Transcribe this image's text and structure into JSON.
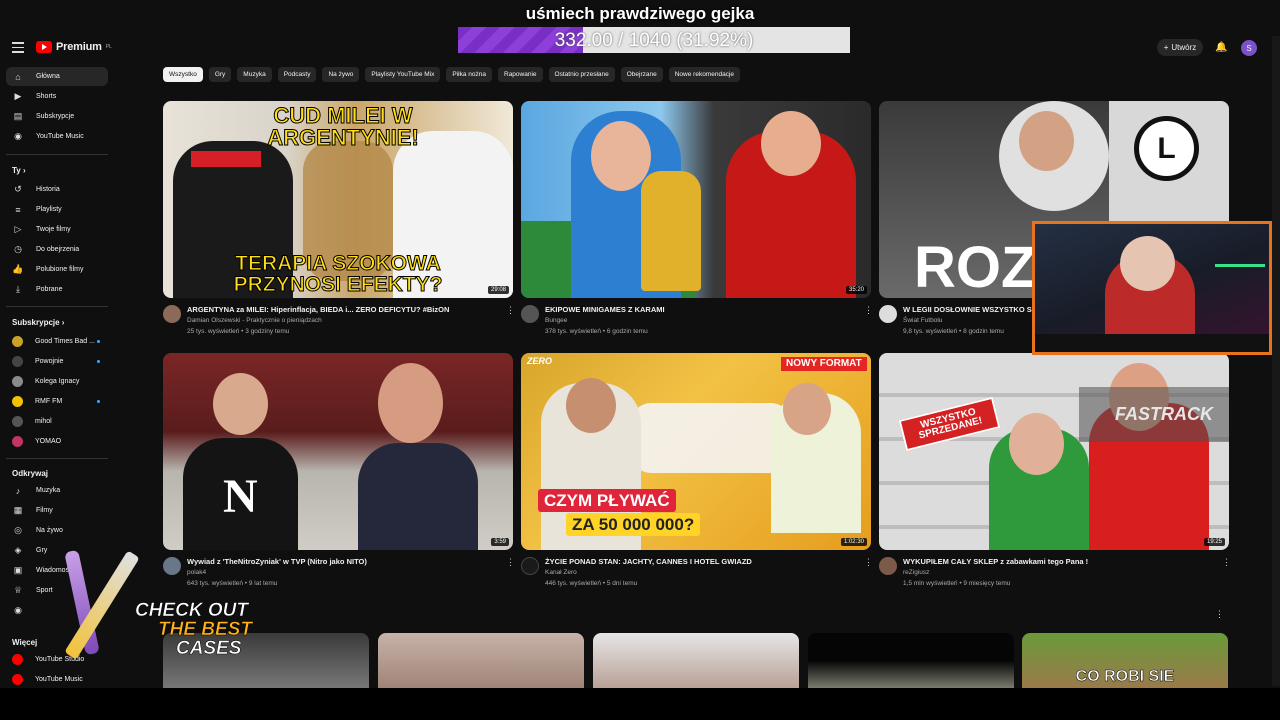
{
  "overlay": {
    "title": "uśmiech prawdziwego gejka",
    "progress_text": "332.00 / 1040 (31.92%)",
    "progress_fraction": 0.3192
  },
  "header": {
    "logo_text": "Premium",
    "logo_region": "PL",
    "create_label": "Utwórz",
    "avatar_letter": "S"
  },
  "sidebar": {
    "main": [
      {
        "label": "Główna",
        "icon": "home-icon"
      },
      {
        "label": "Shorts",
        "icon": "shorts-icon"
      },
      {
        "label": "Subskrypcje",
        "icon": "subscriptions-icon"
      },
      {
        "label": "YouTube Music",
        "icon": "music-icon"
      }
    ],
    "you_heading": "Ty",
    "you": [
      {
        "label": "Historia",
        "icon": "history-icon"
      },
      {
        "label": "Playlisty",
        "icon": "playlist-icon"
      },
      {
        "label": "Twoje filmy",
        "icon": "your-videos-icon"
      },
      {
        "label": "Do obejrzenia",
        "icon": "watch-later-icon"
      },
      {
        "label": "Polubione filmy",
        "icon": "like-icon"
      },
      {
        "label": "Pobrane",
        "icon": "download-icon"
      }
    ],
    "subs_heading": "Subskrypcje",
    "subs": [
      {
        "label": "Good Times Bad ...",
        "color": "#c9a227"
      },
      {
        "label": "Powojnie",
        "color": "#444444"
      },
      {
        "label": "Kolega Ignacy",
        "color": "#8a8a8a"
      },
      {
        "label": "RMF FM",
        "color": "#f2c200"
      },
      {
        "label": "mihol",
        "color": "#555555"
      },
      {
        "label": "YOMAO",
        "color": "#c23366"
      }
    ],
    "explore_heading": "Odkrywaj",
    "explore": [
      {
        "label": "Muzyka",
        "icon": "music-note-icon"
      },
      {
        "label": "Filmy",
        "icon": "film-icon"
      },
      {
        "label": "Na żywo",
        "icon": "live-icon"
      },
      {
        "label": "Gry",
        "icon": "gamepad-icon"
      },
      {
        "label": "Wiadomości",
        "icon": "news-icon"
      },
      {
        "label": "Sport",
        "icon": "trophy-icon"
      },
      {
        "label": "",
        "icon": "podcast-icon"
      }
    ],
    "more_heading": "Więcej",
    "more": [
      {
        "label": "YouTube Studio"
      },
      {
        "label": "YouTube Music"
      }
    ]
  },
  "chips": [
    "Wszystko",
    "Gry",
    "Muzyka",
    "Podcasty",
    "Na żywo",
    "Playlisty YouTube Mix",
    "Piłka nożna",
    "Rapowanie",
    "Ostatnio przesłane",
    "Obejrzane",
    "Nowe rekomendacje"
  ],
  "videos": [
    {
      "title": "ARGENTYNA za MILEI: Hiperinflacja, BIEDA i... ZERO DEFICYTU? #BizON",
      "channel": "Damian Olszewski - Praktycznie o pieniądzach",
      "stats": "25 tys. wyświetleń • 3 godziny temu",
      "duration": "29:08",
      "thumb_top": "CUD MILEI W ARGENTYNIE!",
      "thumb_bottom": "TERAPIA SZOKOWA PRZYNOSI EFEKTY?"
    },
    {
      "title": "EKIPOWE MINIGAMES Z KARAMI",
      "channel": "Bungee",
      "stats": "378 tys. wyświetleń • 6 godzin temu",
      "duration": "35:20"
    },
    {
      "title": "W LEGII DOSŁOWNIE WSZYSTKO SI",
      "channel": "Świat Futbolu",
      "stats": "9,8 tys. wyświetleń • 8 godzin temu",
      "duration": "",
      "thumb_text": "ROZ"
    },
    {
      "title": "Wywiad z 'TheNitroZyniak' w TVP (Nitro jako NITO)",
      "channel": "polak4",
      "stats": "643 tys. wyświetleń • 9 lat temu",
      "duration": "3:59",
      "thumb_shirt": "N"
    },
    {
      "title": "ŻYCIE PONAD STAN: JACHTY, CANNES I HOTEL GWIAZD",
      "channel": "Kanał Zero",
      "stats": "446 tys. wyświetleń • 5 dni temu",
      "duration": "1:02:30",
      "badge": "NOWY FORMAT",
      "thumb_line1": "CZYM PŁYWAĆ",
      "thumb_line2": "ZA 50 000 000?",
      "thumb_logo": "ZERO"
    },
    {
      "title": "WYKUPIŁEM CAŁY SKLEP z zabawkami tego Pana !",
      "channel": "reZigiusz",
      "stats": "1,5 mln wyświetleń • 9 miesięcy temu",
      "duration": "19:25",
      "thumb_sign": "WSZYSTKO SPRZEDANE!",
      "watermark": "FASTRACK"
    }
  ],
  "bottom_row_text": "CO ROBI SIE",
  "ad": {
    "line1": "CHECK OUT",
    "line2": "THE BEST",
    "line3": "CASES"
  }
}
